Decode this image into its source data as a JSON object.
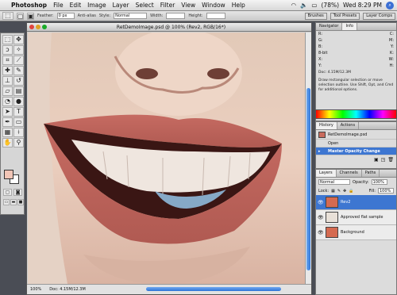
{
  "menubar": {
    "app": "Photoshop",
    "items": [
      "File",
      "Edit",
      "Image",
      "Layer",
      "Select",
      "Filter",
      "View",
      "Window",
      "Help"
    ],
    "battery": "(78%)",
    "clock": "Wed 8:29 PM"
  },
  "options": {
    "feather_label": "Feather:",
    "feather_value": "0 px",
    "antialias_label": "Anti-alias",
    "style_label": "Style:",
    "style_value": "Normal",
    "width_label": "Width:",
    "height_label": "Height:",
    "brushes_label": "Brushes",
    "tool_presets_label": "Tool Presets",
    "layer_comps_label": "Layer Comps"
  },
  "document": {
    "title": "RetDemoImage.psd @ 100% (Rev2, RGB/16*)",
    "zoom": "100%",
    "doc_size": "Doc: 4.15M/12.3M"
  },
  "navigator": {
    "tabs": [
      "Navigator",
      "Info"
    ],
    "info_rows": [
      [
        "R:",
        "C:"
      ],
      [
        "G:",
        "M:"
      ],
      [
        "B:",
        "Y:"
      ],
      [
        "8-bit",
        "K:"
      ],
      [
        "X:",
        "W:"
      ],
      [
        "Y:",
        "H:"
      ]
    ],
    "doc_line": "Doc: 4.15M/12.3M",
    "note": "Draw rectangular selection or move selection outline. Use Shift, Opt, and Cmd for additional options."
  },
  "history": {
    "tabs": [
      "History",
      "Actions"
    ],
    "snapshot": "RetDemoImage.psd",
    "states": [
      "Open",
      "Master Opacity Change"
    ],
    "selected_index": 1
  },
  "layers": {
    "tabs": [
      "Layers",
      "Channels",
      "Paths"
    ],
    "blend_mode": "Normal",
    "opacity_label": "Opacity:",
    "opacity_value": "100%",
    "lock_label": "Lock:",
    "fill_label": "Fill:",
    "fill_value": "100%",
    "items": [
      {
        "name": "Rev2",
        "selected": true
      },
      {
        "name": "Approved flat sample",
        "selected": false
      },
      {
        "name": "Background",
        "selected": false
      }
    ]
  },
  "colors": {
    "accent": "#3d76d1",
    "foreground": "#f1c5b6",
    "background": "#ffffff"
  }
}
